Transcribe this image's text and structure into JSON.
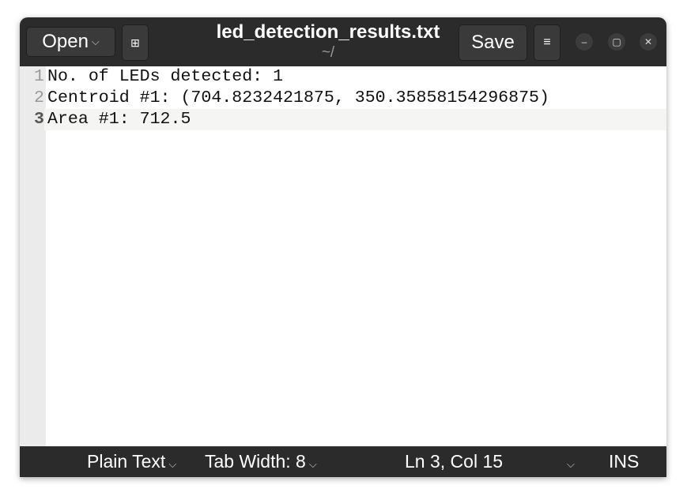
{
  "header": {
    "open_label": "Open",
    "title": "led_detection_results.txt",
    "subtitle": "~/",
    "save_label": "Save"
  },
  "editor": {
    "lines": [
      {
        "number": "1",
        "text": "No. of LEDs detected: 1"
      },
      {
        "number": "2",
        "text": "Centroid #1: (704.8232421875, 350.35858154296875)"
      },
      {
        "number": "3",
        "text": "Area #1: 712.5"
      }
    ]
  },
  "status": {
    "language": "Plain Text",
    "tab_width": "Tab Width: 8",
    "position": "Ln 3, Col 15",
    "mode": "INS"
  }
}
